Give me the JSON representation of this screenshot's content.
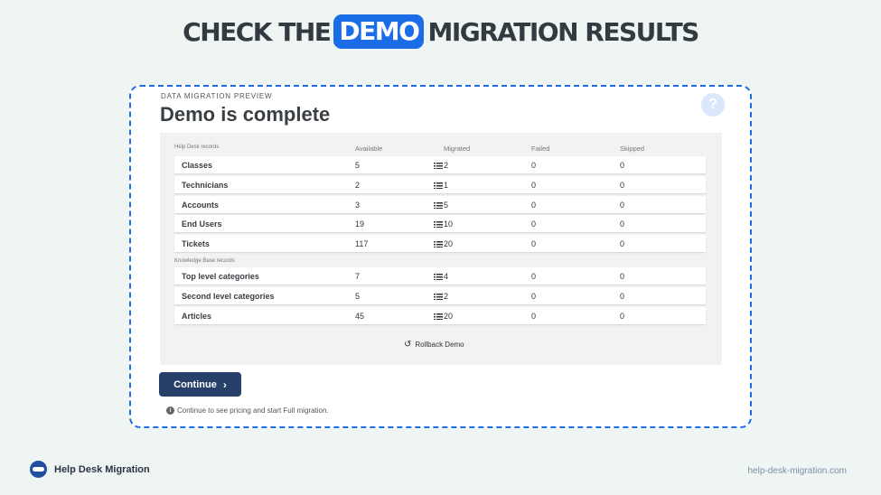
{
  "headline": {
    "part1": "CHECK THE",
    "highlight": "DEMO",
    "part2": "MIGRATION RESULTS"
  },
  "preview": {
    "kicker": "DATA MIGRATION PREVIEW",
    "title": "Demo is complete",
    "help_glyph": "?",
    "columns": {
      "records": "Help Desk records",
      "available": "Available",
      "migrated": "Migrated",
      "failed": "Failed",
      "skipped": "Skipped"
    },
    "helpdesk_rows": [
      {
        "name": "Classes",
        "available": "5",
        "migrated": "2",
        "failed": "0",
        "skipped": "0"
      },
      {
        "name": "Technicians",
        "available": "2",
        "migrated": "1",
        "failed": "0",
        "skipped": "0"
      },
      {
        "name": "Accounts",
        "available": "3",
        "migrated": "5",
        "failed": "0",
        "skipped": "0"
      },
      {
        "name": "End Users",
        "available": "19",
        "migrated": "10",
        "failed": "0",
        "skipped": "0"
      },
      {
        "name": "Tickets",
        "available": "117",
        "migrated": "20",
        "failed": "0",
        "skipped": "0"
      }
    ],
    "kb_section_label": "Knowledge Base records",
    "kb_rows": [
      {
        "name": "Top level categories",
        "available": "7",
        "migrated": "4",
        "failed": "0",
        "skipped": "0"
      },
      {
        "name": "Second level categories",
        "available": "5",
        "migrated": "2",
        "failed": "0",
        "skipped": "0"
      },
      {
        "name": "Articles",
        "available": "45",
        "migrated": "20",
        "failed": "0",
        "skipped": "0"
      }
    ],
    "rollback_label": "Rollback Demo",
    "continue_label": "Continue",
    "continue_note": "Continue to see pricing and start Full migration."
  },
  "footer": {
    "brand": "Help Desk Migration",
    "url": "help-desk-migration.com"
  },
  "colors": {
    "accent": "#1a6de6",
    "button": "#26406a",
    "background": "#eef5f3"
  }
}
